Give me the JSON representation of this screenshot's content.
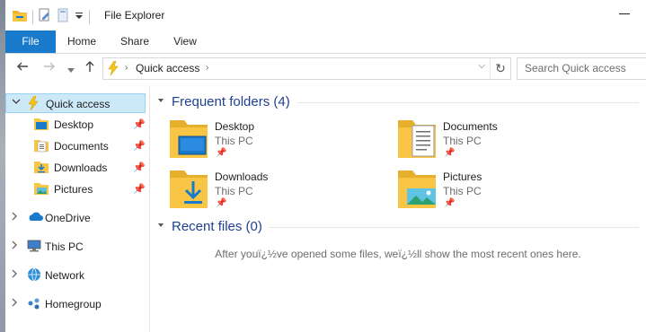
{
  "window": {
    "title": "File Explorer"
  },
  "ribbon": {
    "tabs": [
      "File",
      "Home",
      "Share",
      "View"
    ]
  },
  "address": {
    "path": [
      "Quick access"
    ],
    "search_placeholder": "Search Quick access"
  },
  "nav": {
    "quick_access": "Quick access",
    "pinned": [
      {
        "label": "Desktop",
        "icon": "desktop-folder-icon"
      },
      {
        "label": "Documents",
        "icon": "documents-folder-icon"
      },
      {
        "label": "Downloads",
        "icon": "downloads-folder-icon"
      },
      {
        "label": "Pictures",
        "icon": "pictures-folder-icon"
      }
    ],
    "roots": [
      {
        "label": "OneDrive",
        "icon": "onedrive-icon"
      },
      {
        "label": "This PC",
        "icon": "this-pc-icon"
      },
      {
        "label": "Network",
        "icon": "network-icon"
      },
      {
        "label": "Homegroup",
        "icon": "homegroup-icon"
      }
    ]
  },
  "content": {
    "frequent_title": "Frequent folders (4)",
    "frequent": [
      {
        "name": "Desktop",
        "location": "This PC",
        "icon": "desktop-folder-icon"
      },
      {
        "name": "Documents",
        "location": "This PC",
        "icon": "documents-folder-icon"
      },
      {
        "name": "Downloads",
        "location": "This PC",
        "icon": "downloads-folder-icon"
      },
      {
        "name": "Pictures",
        "location": "This PC",
        "icon": "pictures-folder-icon"
      }
    ],
    "recent_title": "Recent files (0)",
    "empty_message": "After youï¿½ve opened some files, weï¿½ll show the most recent ones here."
  },
  "colors": {
    "accent": "#1979ca",
    "selection": "#cde8f7",
    "folder": "#f8c644"
  }
}
